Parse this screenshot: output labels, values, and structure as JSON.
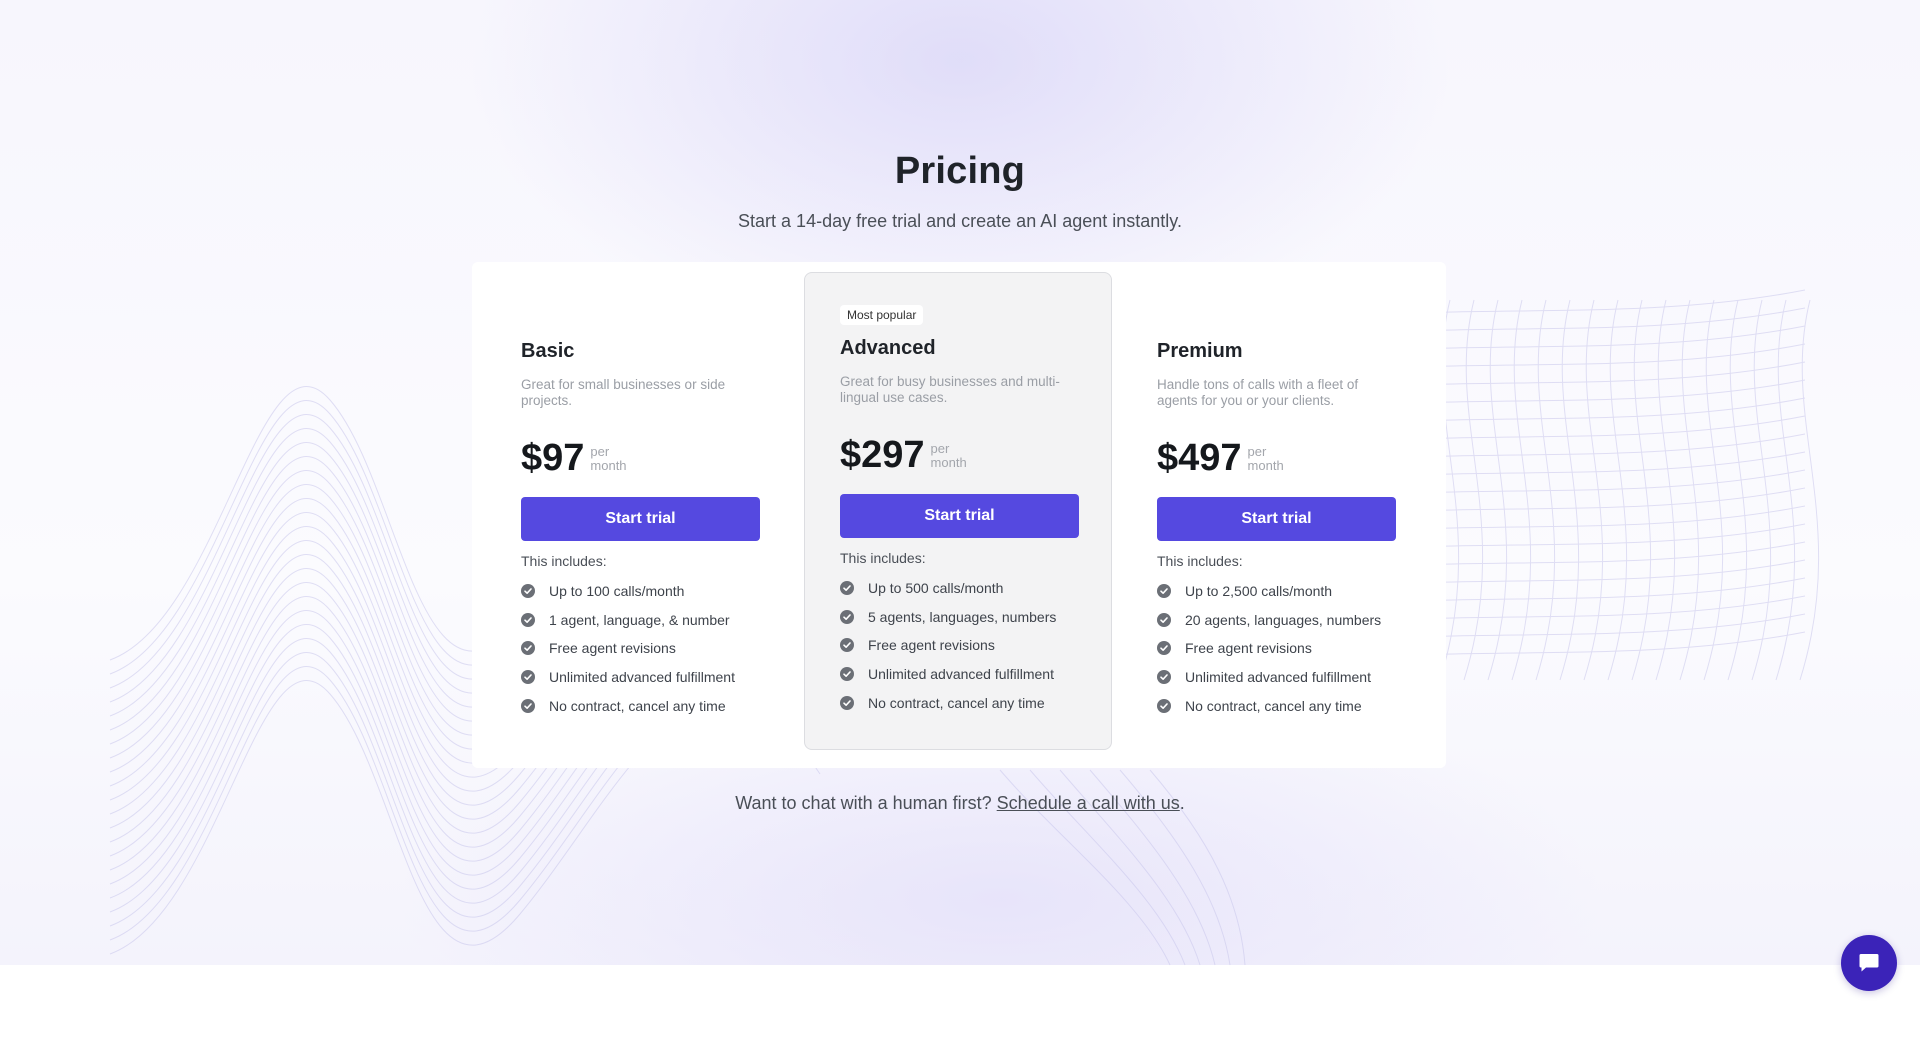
{
  "header": {
    "title": "Pricing",
    "subtitle": "Start a 14-day free trial and create an AI agent instantly."
  },
  "plans": [
    {
      "name": "Basic",
      "description": "Great for small businesses or side projects.",
      "price": "$97",
      "per_line1": "per",
      "per_line2": "month",
      "button_label": "Start trial",
      "includes_label": "This includes:",
      "features": [
        "Up to 100 calls/month",
        "1 agent, language, & number",
        "Free agent revisions",
        "Unlimited advanced fulfillment",
        "No contract, cancel any time"
      ]
    },
    {
      "badge": "Most popular",
      "name": "Advanced",
      "description": "Great for busy businesses and multi-lingual use cases.",
      "price": "$297",
      "per_line1": "per",
      "per_line2": "month",
      "button_label": "Start trial",
      "includes_label": "This includes:",
      "features": [
        "Up to 500 calls/month",
        "5 agents, languages, numbers",
        "Free agent revisions",
        "Unlimited advanced fulfillment",
        "No contract, cancel any time"
      ]
    },
    {
      "name": "Premium",
      "description": "Handle tons of calls with a fleet of agents for you or your clients.",
      "price": "$497",
      "per_line1": "per",
      "per_line2": "month",
      "button_label": "Start trial",
      "includes_label": "This includes:",
      "features": [
        "Up to 2,500 calls/month",
        "20 agents, languages, numbers",
        "Free agent revisions",
        "Unlimited advanced fulfillment",
        "No contract, cancel any time"
      ]
    }
  ],
  "footer": {
    "prefix": "Want to chat with a human first?",
    "link_text": "Schedule a call with us",
    "suffix": "."
  },
  "icons": {
    "feature_check": "check-circle-icon",
    "chat": "chat-bubble-icon"
  },
  "colors": {
    "accent": "#5549e0",
    "chat_button": "#3b23b8",
    "check": "#6b6f76"
  }
}
